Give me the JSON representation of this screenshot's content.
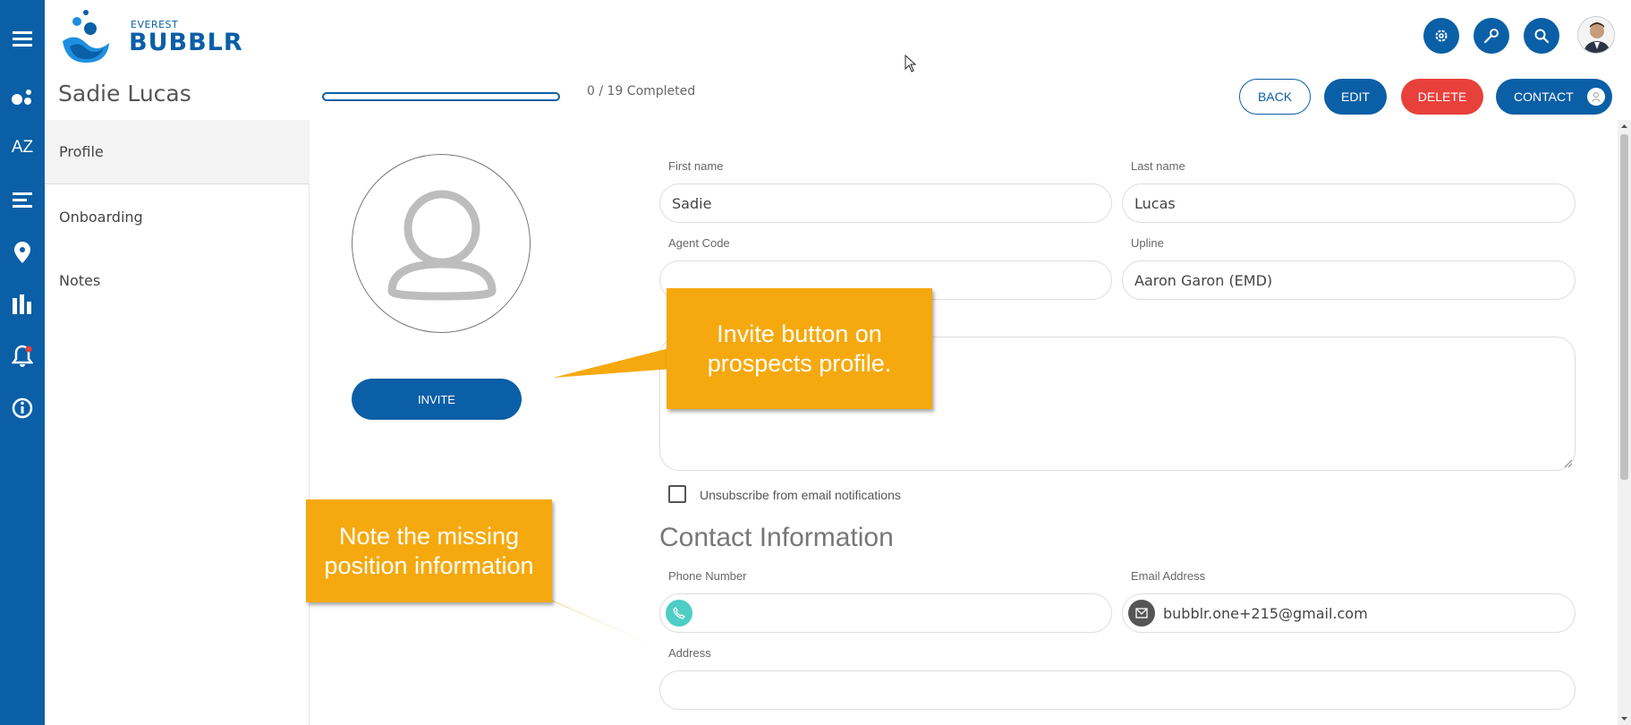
{
  "app": {
    "brand_small": "EVEREST",
    "brand_big": "BUBBLR"
  },
  "colors": {
    "primary": "#0a5fa6",
    "danger": "#e8403a",
    "callout": "#f6a90e",
    "phone_icon_bg": "#4ecdc4",
    "email_icon_bg": "#555555"
  },
  "rail": {
    "icons": [
      "menu-icon",
      "bubbles-icon",
      "az-icon",
      "list-icon",
      "map-pin-icon",
      "chart-icon",
      "bell-icon",
      "info-icon"
    ],
    "az_label": "AZ"
  },
  "topbar": {
    "icons": [
      "gear-icon",
      "wrench-icon",
      "search-icon"
    ]
  },
  "header": {
    "name": "Sadie Lucas",
    "progress_text": "0 / 19 Completed",
    "progress_value": 0,
    "back_label": "BACK",
    "edit_label": "EDIT",
    "delete_label": "DELETE",
    "contact_label": "CONTACT"
  },
  "sidebar": {
    "items": [
      {
        "label": "Profile",
        "active": true
      },
      {
        "label": "Onboarding",
        "active": false
      },
      {
        "label": "Notes",
        "active": false
      }
    ]
  },
  "profile": {
    "invite_label": "INVITE",
    "first_name_label": "First name",
    "first_name_value": "Sadie",
    "last_name_label": "Last name",
    "last_name_value": "Lucas",
    "agent_code_label": "Agent Code",
    "agent_code_value": "",
    "upline_label": "Upline",
    "upline_value": "Aaron Garon (EMD)",
    "unsubscribe_label": "Unsubscribe from email notifications",
    "unsubscribe_checked": false
  },
  "contact": {
    "section_title": "Contact Information",
    "phone_label": "Phone Number",
    "phone_value": "",
    "email_label": "Email Address",
    "email_value": "bubblr.one+215@gmail.com",
    "address_label": "Address",
    "address_value": ""
  },
  "callouts": {
    "invite_note": "Invite button on prospects profile.",
    "position_note": "Note the missing position information"
  }
}
